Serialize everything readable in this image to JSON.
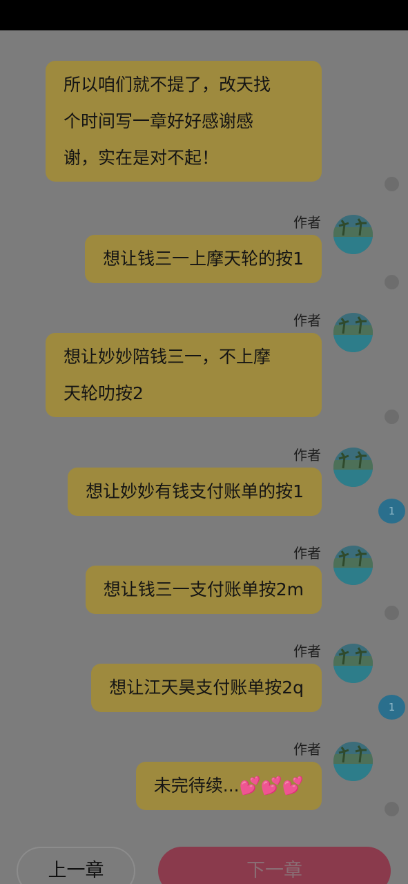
{
  "chat": {
    "messages": [
      {
        "author": "",
        "lines": [
          "所以咱们就不提了，改天找",
          "个时间写一章好好感谢感",
          "谢，实在是对不起！"
        ],
        "badge": ""
      },
      {
        "author": "作者",
        "lines": [
          "想让钱三一上摩天轮的按1"
        ],
        "badge": ""
      },
      {
        "author": "作者",
        "lines": [
          "想让妙妙陪钱三一，不上摩",
          "天轮叻按2"
        ],
        "badge": ""
      },
      {
        "author": "作者",
        "lines": [
          "想让妙妙有钱支付账单的按1"
        ],
        "badge": "1"
      },
      {
        "author": "作者",
        "lines": [
          "想让钱三一支付账单按2m"
        ],
        "badge": ""
      },
      {
        "author": "作者",
        "lines": [
          "想让江天昊支付账单按2q"
        ],
        "badge": "1"
      },
      {
        "author": "作者",
        "lines": [
          "未完待续...💕💕💕"
        ],
        "badge": ""
      }
    ]
  },
  "footer": {
    "prev_label": "上一章",
    "next_label": "下一章"
  },
  "colors": {
    "bubble": "#9e8a3e",
    "badge": "#2a6f8d",
    "next_button": "#8a3a4c"
  }
}
